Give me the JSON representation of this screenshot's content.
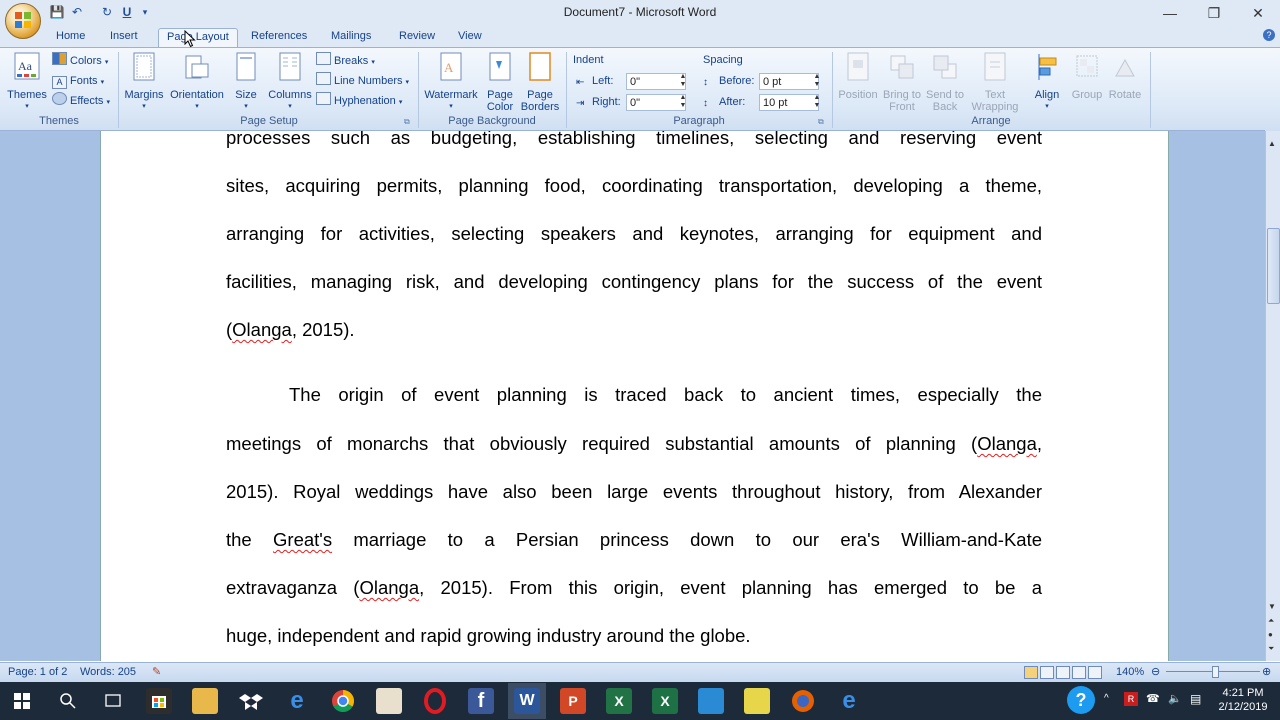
{
  "window": {
    "title": "Document7 - Microsoft Word",
    "controls": {
      "minimize": "—",
      "restore": "❐",
      "close": "✕"
    }
  },
  "qat": {
    "save": "💾",
    "undo": "↶",
    "redo": "↻",
    "underline": "U"
  },
  "tabs": [
    "Home",
    "Insert",
    "Page Layout",
    "References",
    "Mailings",
    "Review",
    "View"
  ],
  "active_tab": "Page Layout",
  "ribbon": {
    "themes": {
      "themes_label": "Themes",
      "colors": "Colors",
      "fonts": "Fonts",
      "effects": "Effects",
      "group": "Themes"
    },
    "page_setup": {
      "margins": "Margins",
      "orientation": "Orientation",
      "size": "Size",
      "columns": "Columns",
      "breaks": "Breaks",
      "line_numbers": "Line Numbers",
      "hyphenation": "Hyphenation",
      "group": "Page Setup"
    },
    "page_background": {
      "watermark": "Watermark",
      "page_color_1": "Page",
      "page_color_2": "Color",
      "page_borders_1": "Page",
      "page_borders_2": "Borders",
      "group": "Page Background"
    },
    "paragraph": {
      "indent": "Indent",
      "left_label": "Left:",
      "left_value": "0\"",
      "right_label": "Right:",
      "right_value": "0\"",
      "spacing": "Spacing",
      "before_label": "Before:",
      "before_value": "0 pt",
      "after_label": "After:",
      "after_value": "10 pt",
      "group": "Paragraph"
    },
    "arrange": {
      "position": "Position",
      "bring_1": "Bring to",
      "bring_2": "Front",
      "send_1": "Send to",
      "send_2": "Back",
      "wrap_1": "Text",
      "wrap_2": "Wrapping",
      "align": "Align",
      "group_btn": "Group",
      "rotate": "Rotate",
      "group": "Arrange"
    }
  },
  "document": {
    "lines": [
      "processes such as budgeting, establishing timelines, selecting and reserving event",
      "sites, acquiring permits, planning food, coordinating transportation, developing a theme,",
      "arranging for activities, selecting speakers and keynotes, arranging for equipment and",
      "facilities, managing risk, and developing contingency plans for the success of the event",
      "(Olanga, 2015).",
      "The origin of event planning is traced back to ancient times, especially the",
      "meetings of monarchs that obviously required substantial amounts of planning (Olanga,",
      "2015). Royal weddings have also been large events throughout history, from Alexander",
      "the Great's marriage to a Persian princess down to our era's William-and-Kate",
      "extravaganza (Olanga, 2015).  From this origin, event planning has emerged to be a",
      "huge, independent and rapid growing industry around the globe."
    ]
  },
  "status": {
    "page": "Page: 1 of 2",
    "words": "Words: 205",
    "zoom": "140%"
  },
  "taskbar": {
    "time": "4:21 PM",
    "date": "2/12/2019"
  }
}
